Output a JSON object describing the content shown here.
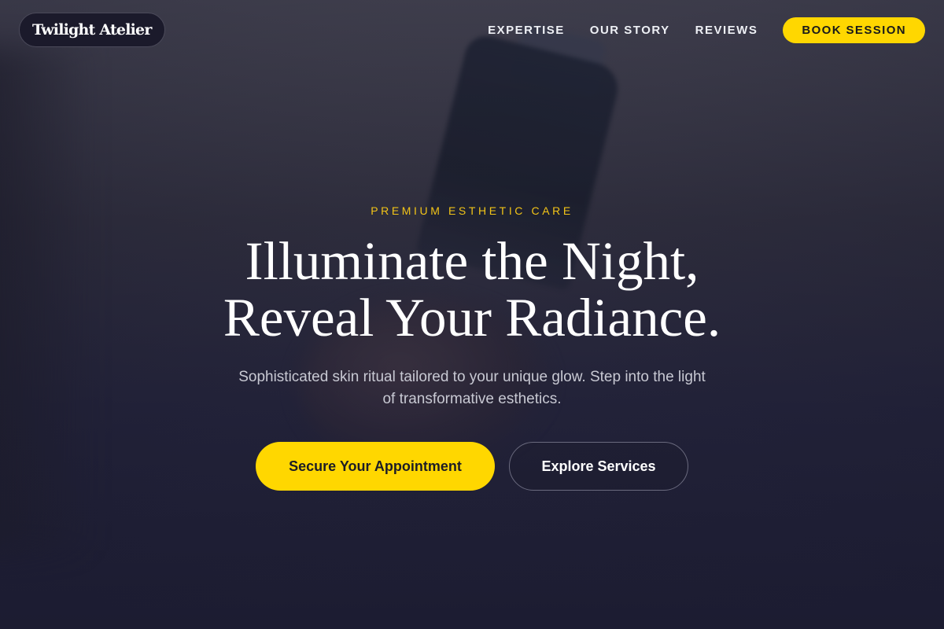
{
  "brand": {
    "name": "Twilight Atelier"
  },
  "nav": {
    "items": [
      {
        "label": "EXPERTISE"
      },
      {
        "label": "OUR STORY"
      },
      {
        "label": "REVIEWS"
      }
    ],
    "cta_label": "BOOK SESSION"
  },
  "hero": {
    "eyebrow": "PREMIUM ESTHETIC CARE",
    "headline_line1": "Illuminate the Night,",
    "headline_line2": "Reveal Your Radiance.",
    "subtext_line1": "Sophisticated skin ritual tailored to your unique glow. Step into the light",
    "subtext_line2": "of transformative esthetics.",
    "primary_cta": "Secure Your Appointment",
    "secondary_cta": "Explore Services"
  },
  "colors": {
    "accent": "#ffd700",
    "eyebrow": "#f2c417",
    "background_top": "#474653",
    "background_bottom": "#1d1d33"
  }
}
